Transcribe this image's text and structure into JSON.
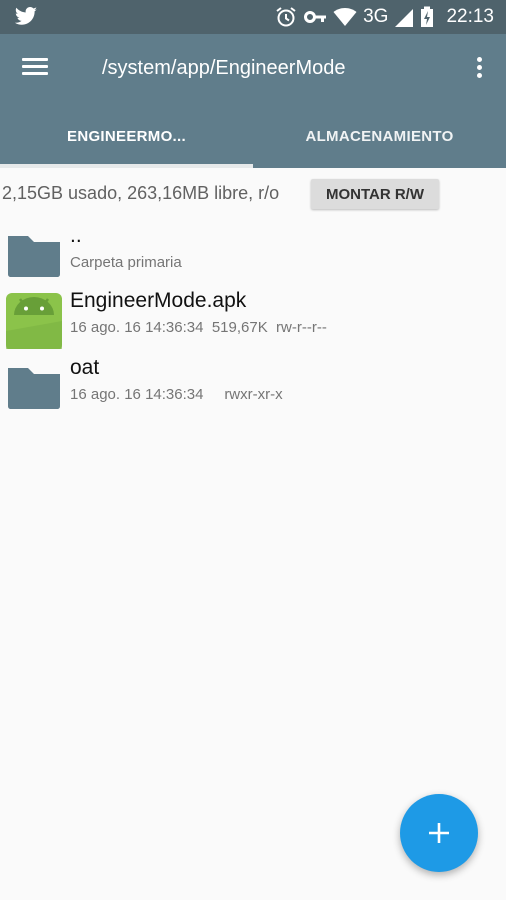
{
  "status_bar": {
    "notification_icon": "twitter-bird-icon",
    "network": "3G",
    "time": "22:13"
  },
  "toolbar": {
    "path": "/system/app/EngineerMode"
  },
  "tabs": [
    {
      "label": "ENGINEERMO...",
      "active": true
    },
    {
      "label": "ALMACENAMIENTO",
      "active": false
    }
  ],
  "storage": {
    "summary": "2,15GB usado, 263,16MB libre, r/o",
    "mount_label": "MONTAR R/W"
  },
  "files": [
    {
      "name": "..",
      "date": "",
      "size": "",
      "perms": "",
      "subtitle": "Carpeta primaria",
      "icon": "folder-icon"
    },
    {
      "name": "EngineerMode.apk",
      "date": "16 ago. 16 14:36:34",
      "size": "519,67K",
      "perms": "rw-r--r--",
      "icon": "android-apk-icon"
    },
    {
      "name": "oat",
      "date": "16 ago. 16 14:36:34",
      "size": "",
      "perms": "rwxr-xr-x",
      "icon": "folder-icon"
    }
  ],
  "colors": {
    "status_bar": "#4f636c",
    "toolbar": "#607d8b",
    "fab": "#1e9ae6",
    "folder": "#607d8b",
    "android": "#8bc34a"
  }
}
